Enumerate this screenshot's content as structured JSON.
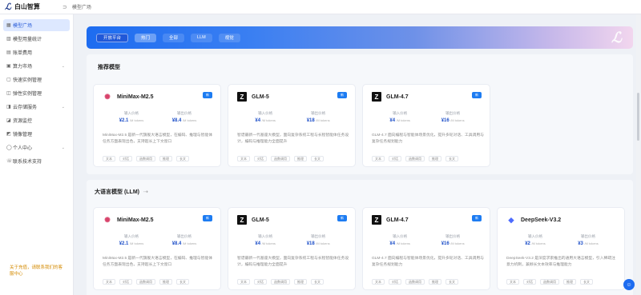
{
  "header": {
    "logo_mark": "ℒ",
    "logo_text": "白山智算",
    "breadcrumb_icon": "⊃",
    "breadcrumb": "模型广场"
  },
  "sidebar": {
    "items": [
      {
        "label": "模型广场",
        "icon": "▦",
        "active": true
      },
      {
        "label": "模型用量统计",
        "icon": "▥"
      },
      {
        "label": "账单费用",
        "icon": "▤"
      },
      {
        "label": "算力市场",
        "icon": "▣",
        "arrow": "⌄"
      },
      {
        "label": "快速实例管理",
        "icon": "▢"
      },
      {
        "label": "弹性实例管理",
        "icon": "◫"
      },
      {
        "label": "云存储服务",
        "icon": "◨",
        "arrow": "⌄"
      },
      {
        "label": "资源监控",
        "icon": "◪"
      },
      {
        "label": "镜像管理",
        "icon": "◩"
      },
      {
        "label": "个人中心",
        "icon": "◯",
        "arrow": "⌄"
      },
      {
        "label": "联系技术支持",
        "icon": "☏"
      }
    ],
    "note": "关于充值，请联系我们的客服中心"
  },
  "hero": {
    "buttons": [
      "开放平台",
      "热门",
      "全部",
      "LLM",
      "视觉"
    ],
    "deco": "ℒ"
  },
  "recommended": {
    "title": "推荐模型",
    "cards": [
      {
        "logo": "✺",
        "logo_type": "mm",
        "name": "MiniMax-M2.5",
        "badge": "新",
        "in_label": "输入价格",
        "in_val": "¥2.1",
        "in_unit": "/M tokens",
        "out_label": "输出价格",
        "out_val": "¥8.4",
        "out_unit": "/M tokens",
        "desc": "MiniMax-M2.5 是新一代旗舰大语言模型，在编码、推理与智能体任务方面表现出色，支持超长上下文窗口",
        "tags": [
          "文本",
          "对话",
          "函数调用",
          "推理",
          "长文"
        ]
      },
      {
        "logo": "Z",
        "logo_type": "z",
        "name": "GLM-5",
        "badge": "新",
        "in_label": "输入价格",
        "in_val": "¥4",
        "in_unit": "/M tokens",
        "out_label": "输出价格",
        "out_val": "¥18",
        "out_unit": "/M tokens",
        "desc": "智谱最新一代基座大模型，面向复杂系统工程与长程智能体任务设计，编码与推理能力全面提升",
        "tags": [
          "文本",
          "对话",
          "函数调用",
          "推理",
          "长文"
        ]
      },
      {
        "logo": "Z",
        "logo_type": "z",
        "name": "GLM-4.7",
        "badge": "新",
        "in_label": "输入价格",
        "in_val": "¥4",
        "in_unit": "/M tokens",
        "out_label": "输出价格",
        "out_val": "¥16",
        "out_unit": "/M tokens",
        "desc": "GLM-4.7 面向编程与智能体场景优化，提升多轮对话、工具调用与复杂任务规划能力",
        "tags": [
          "文本",
          "对话",
          "函数调用",
          "推理",
          "长文"
        ]
      }
    ]
  },
  "llm": {
    "title": "大语言模型 (LLM)",
    "title_icon": "⇢",
    "cards": [
      {
        "logo": "✺",
        "logo_type": "mm",
        "name": "MiniMax-M2.5",
        "badge": "新",
        "in_label": "输入价格",
        "in_val": "¥2.1",
        "in_unit": "/M tokens",
        "out_label": "输出价格",
        "out_val": "¥8.4",
        "out_unit": "/M tokens",
        "desc": "MiniMax-M2.5 是新一代旗舰大语言模型，在编码、推理与智能体任务方面表现出色，支持超长上下文窗口",
        "tags": [
          "文本",
          "对话",
          "函数调用",
          "推理",
          "长文"
        ]
      },
      {
        "logo": "Z",
        "logo_type": "z",
        "name": "GLM-5",
        "badge": "新",
        "in_label": "输入价格",
        "in_val": "¥4",
        "in_unit": "/M tokens",
        "out_label": "输出价格",
        "out_val": "¥18",
        "out_unit": "/M tokens",
        "desc": "智谱最新一代基座大模型，面向复杂系统工程与长程智能体任务设计，编码与推理能力全面提升",
        "tags": [
          "文本",
          "对话",
          "函数调用",
          "推理",
          "长文"
        ]
      },
      {
        "logo": "Z",
        "logo_type": "z",
        "name": "GLM-4.7",
        "badge": "新",
        "in_label": "输入价格",
        "in_val": "¥4",
        "in_unit": "/M tokens",
        "out_label": "输出价格",
        "out_val": "¥16",
        "out_unit": "/M tokens",
        "desc": "GLM-4.7 面向编程与智能体场景优化，提升多轮对话、工具调用与复杂任务规划能力",
        "tags": [
          "文本",
          "对话",
          "函数调用",
          "推理",
          "长文"
        ]
      },
      {
        "logo": "◆",
        "logo_type": "ds",
        "name": "DeepSeek-V3.2",
        "badge": "",
        "in_label": "输入价格",
        "in_val": "¥2",
        "in_unit": "/M tokens",
        "out_label": "输出价格",
        "out_val": "¥3",
        "out_unit": "/M tokens",
        "desc": "DeepSeek-V3.2 是深度求索推出的通用大语言模型，引入稀疏注意力机制，兼顾长文本效率与推理能力",
        "tags": [
          "文本",
          "对话",
          "函数调用",
          "推理",
          "长文"
        ]
      }
    ]
  },
  "float_icon": "☺",
  "colors": {
    "accent": "#1d6cf0",
    "price": "#1d4fc8",
    "active_bg": "#dde8ff"
  }
}
